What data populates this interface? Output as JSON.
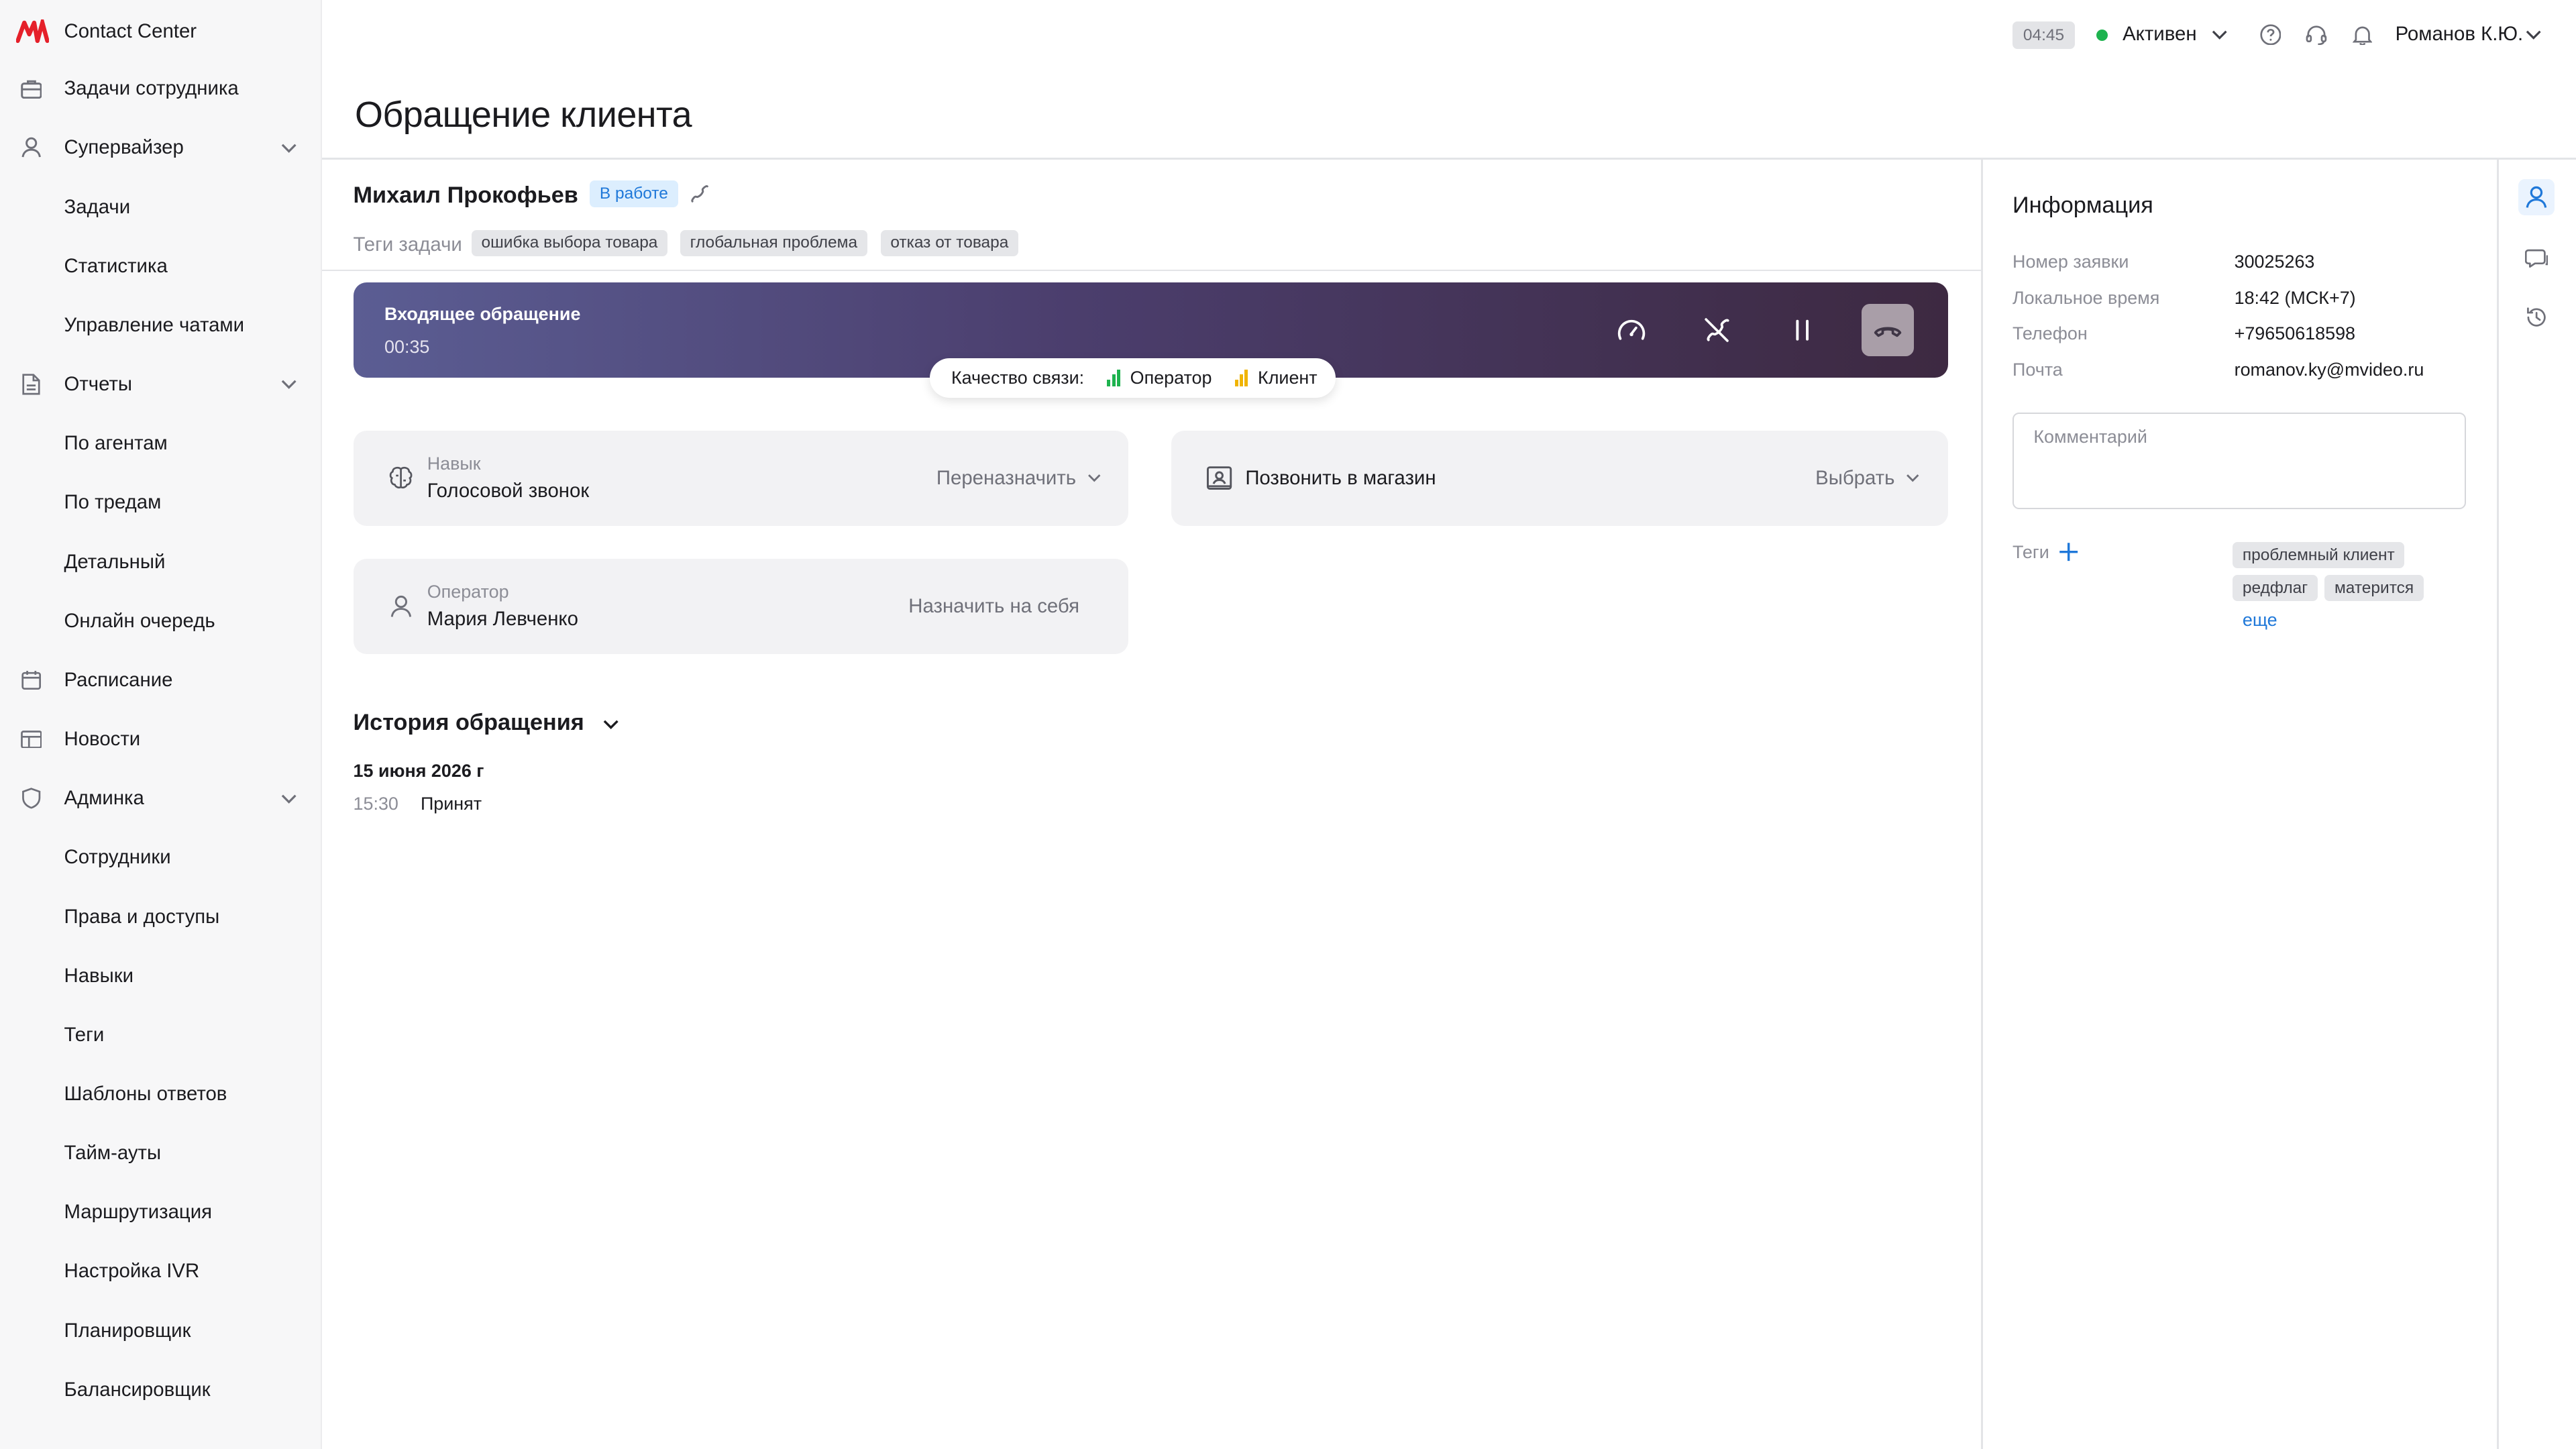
{
  "app": {
    "name": "Contact Center",
    "brand_color": "#e5202a"
  },
  "sidebar": {
    "items": [
      {
        "label": "Задачи сотрудника",
        "icon": "briefcase-icon",
        "level": 0
      },
      {
        "label": "Супервайзер",
        "icon": "user-icon",
        "level": 0,
        "expanded": true
      },
      {
        "label": "Задачи",
        "level": 1
      },
      {
        "label": "Статистика",
        "level": 1
      },
      {
        "label": "Управление чатами",
        "level": 1
      },
      {
        "label": "Отчеты",
        "icon": "document-icon",
        "level": 0,
        "expanded": true
      },
      {
        "label": "По агентам",
        "level": 1
      },
      {
        "label": "По тредам",
        "level": 1
      },
      {
        "label": "Детальный",
        "level": 1
      },
      {
        "label": "Онлайн очередь",
        "level": 1
      },
      {
        "label": "Расписание",
        "icon": "calendar-icon",
        "level": 0
      },
      {
        "label": "Новости",
        "icon": "news-icon",
        "level": 0
      },
      {
        "label": "Админка",
        "icon": "shield-icon",
        "level": 0,
        "expanded": true
      },
      {
        "label": "Сотрудники",
        "level": 1
      },
      {
        "label": "Права и доступы",
        "level": 1
      },
      {
        "label": "Навыки",
        "level": 1
      },
      {
        "label": "Теги",
        "level": 1
      },
      {
        "label": "Шаблоны ответов",
        "level": 1
      },
      {
        "label": "Тайм-ауты",
        "level": 1
      },
      {
        "label": "Маршрутизация",
        "level": 1
      },
      {
        "label": "Настройка IVR",
        "level": 1
      },
      {
        "label": "Планировщик",
        "level": 1
      },
      {
        "label": "Балансировщик",
        "level": 1
      }
    ]
  },
  "topbar": {
    "timer": "04:45",
    "status": "Активен",
    "status_color": "#1eb34f",
    "user": "Романов К.Ю."
  },
  "page": {
    "title": "Обращение клиента"
  },
  "client": {
    "name": "Михаил Прокофьев",
    "status_badge": "В работе",
    "tags_label": "Теги задачи",
    "tags": [
      "ошибка выбора товара",
      "глобальная проблема",
      "отказ от товара"
    ]
  },
  "call": {
    "title": "Входящее обращение",
    "duration": "00:35",
    "quality_label": "Качество связи:",
    "operator_label": "Оператор",
    "client_label": "Клиент",
    "operator_quality_color": "#1eb34f",
    "client_quality_color": "#f0b400"
  },
  "cards": {
    "skill": {
      "caption": "Навык",
      "value": "Голосовой звонок",
      "action": "Переназначить"
    },
    "store": {
      "value": "Позвонить в магазин",
      "action": "Выбрать"
    },
    "operator": {
      "caption": "Оператор",
      "value": "Мария Левченко",
      "action": "Назначить на себя"
    }
  },
  "history": {
    "title": "История обращения",
    "date": "15 июня 2026 г",
    "events": [
      {
        "time": "15:30",
        "text": "Принят"
      }
    ]
  },
  "info": {
    "title": "Информация",
    "rows": [
      {
        "label": "Номер заявки",
        "value": "30025263"
      },
      {
        "label": "Локальное время",
        "value": "18:42 (МСК+7)"
      },
      {
        "label": "Телефон",
        "value": "+79650618598"
      },
      {
        "label": "Почта",
        "value": "romanov.ky@mvideo.ru"
      }
    ],
    "comment_placeholder": "Комментарий",
    "tags_label": "Теги",
    "tags": [
      "проблемный клиент",
      "редфлаг",
      "матерится"
    ],
    "more_label": "еще"
  }
}
